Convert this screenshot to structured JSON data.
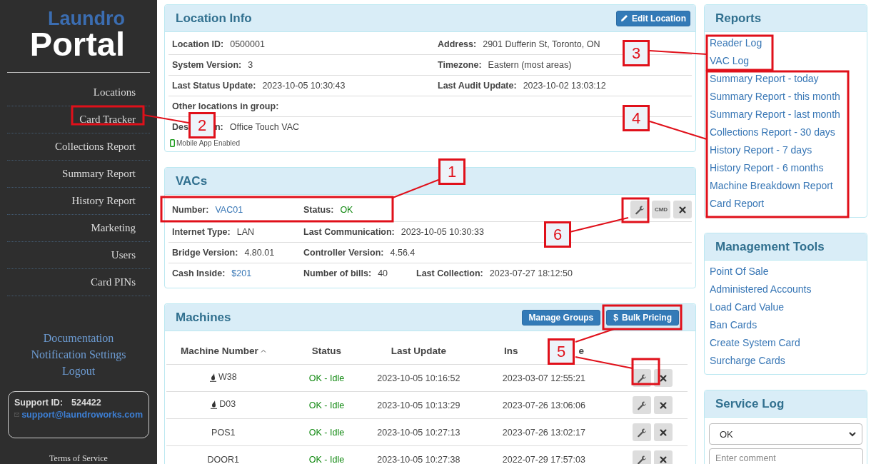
{
  "sidebar": {
    "logo_top": "Laundro",
    "logo_bottom": "Portal",
    "nav": [
      {
        "label": "Locations"
      },
      {
        "label": "Card Tracker"
      },
      {
        "label": "Collections Report"
      },
      {
        "label": "Summary Report"
      },
      {
        "label": "History Report"
      },
      {
        "label": "Marketing"
      },
      {
        "label": "Users"
      },
      {
        "label": "Card PINs"
      }
    ],
    "links": [
      "Documentation",
      "Notification Settings",
      "Logout"
    ],
    "support": {
      "label": "Support ID:",
      "id": "524422",
      "email": "support@laundroworks.com"
    },
    "footer": "Terms of Service"
  },
  "location_info": {
    "title": "Location Info",
    "button": "Edit Location",
    "rows": [
      [
        {
          "label": "Location ID:",
          "value": "0500001"
        },
        {
          "label": "Address:",
          "value": "2901 Dufferin St, Toronto, ON"
        }
      ],
      [
        {
          "label": "System Version:",
          "value": "3"
        },
        {
          "label": "Timezone:",
          "value": "Eastern (most areas)"
        }
      ],
      [
        {
          "label": "Last Status Update:",
          "value": "2023-10-05 10:30:43"
        },
        {
          "label": "Last Audit Update:",
          "value": "2023-10-02 13:03:12"
        }
      ],
      [
        {
          "label": "Other locations in group:"
        }
      ],
      [
        {
          "label": "Des",
          "label_end": "n:",
          "value": "Office Touch VAC"
        }
      ]
    ],
    "mobile_app": "Mobile App Enabled"
  },
  "vacs": {
    "title": "VACs",
    "cmd": "CMD",
    "rows": [
      [
        {
          "label": "Number:",
          "value": "VAC01",
          "kind": "link"
        },
        {
          "label": "Status:",
          "value": "OK",
          "kind": "ok"
        }
      ],
      [
        {
          "label": "Internet Type:",
          "value": "LAN",
          "kind": "plain"
        },
        {
          "label": "Last Communication:",
          "value": "2023-10-05 10:30:33",
          "kind": "plain"
        }
      ],
      [
        {
          "label": "Bridge Version:",
          "value": "4.80.01",
          "kind": "plain"
        },
        {
          "label": "Controller Version:",
          "value": "4.56.4",
          "kind": "plain"
        }
      ],
      [
        {
          "label": "Cash Inside:",
          "value": "$201",
          "kind": "link"
        },
        {
          "label": "Number of bills:",
          "value": "40",
          "kind": "plain"
        },
        {
          "label": "Last Collection:",
          "value": "2023-07-27 18:12:50",
          "kind": "plain"
        }
      ]
    ]
  },
  "machines": {
    "title": "Machines",
    "buttons": [
      {
        "label": "Manage Groups"
      },
      {
        "label": "Bulk Pricing",
        "icon": "$"
      }
    ],
    "columns": [
      {
        "label": "Machine Number",
        "sorted": true
      },
      {
        "label": "Status",
        "sorted": false
      },
      {
        "label": "Last Update",
        "sorted": false
      },
      {
        "label": "Ins",
        "label_end": "e",
        "sorted": false
      }
    ],
    "rows": [
      {
        "number": "W38",
        "drop_icon": true,
        "status": "OK - Idle",
        "last_update": "2023-10-05 10:16:52",
        "install": "2023-03-07 12:55:21"
      },
      {
        "number": "D03",
        "drop_icon": true,
        "status": "OK - Idle",
        "last_update": "2023-10-05 10:13:29",
        "install": "2023-07-26 13:06:06"
      },
      {
        "number": "POS1",
        "drop_icon": false,
        "status": "OK - Idle",
        "last_update": "2023-10-05 10:27:13",
        "install": "2023-07-26 13:02:17"
      },
      {
        "number": "DOOR1",
        "drop_icon": false,
        "status": "OK - Idle",
        "last_update": "2023-10-05 10:27:38",
        "install": "2022-07-29 17:57:03"
      }
    ]
  },
  "reports": {
    "title": "Reports",
    "items": [
      "Reader Log",
      "VAC Log",
      "Summary Report - today",
      "Summary Report - this month",
      "Summary Report - last month",
      "Collections Report - 30 days",
      "History Report - 7 days",
      "History Report - 6 months",
      "Machine Breakdown Report",
      "Card Report"
    ]
  },
  "management": {
    "title": "Management Tools",
    "items": [
      "Point Of Sale",
      "Administered Accounts",
      "Load Card Value",
      "Ban Cards",
      "Create System Card",
      "Surcharge Cards"
    ]
  },
  "service_log": {
    "title": "Service Log",
    "select": "OK",
    "comment_placeholder": "Enter comment"
  },
  "callouts": [
    {
      "number": "1"
    },
    {
      "number": "2"
    },
    {
      "number": "3"
    },
    {
      "number": "4"
    },
    {
      "number": "5"
    },
    {
      "number": "6"
    }
  ]
}
